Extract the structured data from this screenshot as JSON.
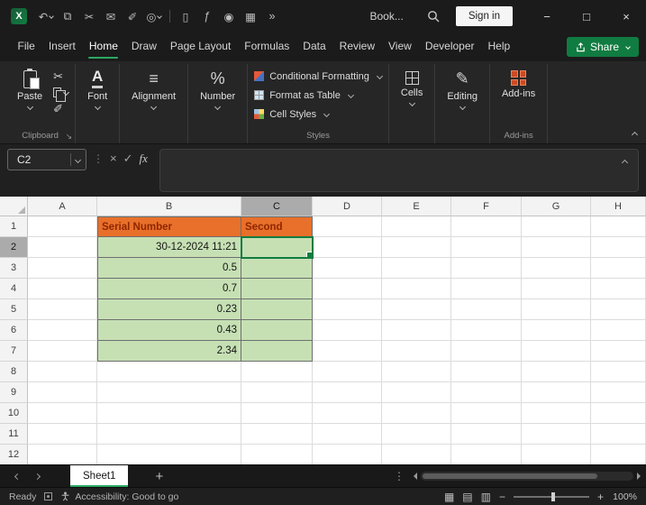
{
  "colors": {
    "accent_green": "#107C41",
    "underline_green": "#2BA862",
    "header_fill": "#E8702A",
    "header_text": "#8F2600",
    "data_fill": "#C6E0B4",
    "addins_orange": "#CE4A22",
    "selected_header_bg": "#ABABAB"
  },
  "titlebar": {
    "workbook_name": "Book...",
    "sign_in_label": "Sign in",
    "quick_access_icons": [
      {
        "name": "undo-icon",
        "glyph": "↶",
        "chevron": true
      },
      {
        "name": "copy-icon",
        "glyph": "⧉"
      },
      {
        "name": "cut-icon",
        "glyph": "✂"
      },
      {
        "name": "mail-icon",
        "glyph": "✉"
      },
      {
        "name": "format-painter-icon",
        "glyph": "✐"
      },
      {
        "name": "record-icon",
        "glyph": "◎",
        "chevron": true
      },
      {
        "name": "separator",
        "type": "sep"
      },
      {
        "name": "new-document-icon",
        "glyph": "▯"
      },
      {
        "name": "function-icon",
        "glyph": "ƒ"
      },
      {
        "name": "camera-icon",
        "glyph": "◉"
      },
      {
        "name": "table-icon",
        "glyph": "▦"
      },
      {
        "name": "more-commands-icon",
        "glyph": "»"
      }
    ]
  },
  "menubar": {
    "items": [
      "File",
      "Insert",
      "Home",
      "Draw",
      "Page Layout",
      "Formulas",
      "Data",
      "Review",
      "View",
      "Developer",
      "Help"
    ],
    "active_item": "Home",
    "share_label": "Share"
  },
  "ribbon": {
    "paste_label": "Paste",
    "font_label": "Font",
    "alignment_label": "Alignment",
    "number_label": "Number",
    "styles_buttons": [
      "Conditional Formatting",
      "Format as Table",
      "Cell Styles"
    ],
    "cells_label": "Cells",
    "editing_label": "Editing",
    "addins_label": "Add-ins",
    "group_labels": {
      "clipboard": "Clipboard",
      "styles": "Styles",
      "addins": "Add-ins"
    }
  },
  "formula_bar": {
    "name_box_value": "C2",
    "formula_value": ""
  },
  "grid": {
    "column_headers": [
      "A",
      "B",
      "C",
      "D",
      "E",
      "F",
      "G",
      "H"
    ],
    "row_headers": [
      "1",
      "2",
      "3",
      "4",
      "5",
      "6",
      "7",
      "8",
      "9",
      "10",
      "11",
      "12"
    ],
    "selected_column": "C",
    "selected_row": "2",
    "active_cell": "C2",
    "cells": [
      {
        "ref": "B1",
        "text": "Serial Number",
        "style": "header"
      },
      {
        "ref": "C1",
        "text": "Second",
        "style": "header"
      },
      {
        "ref": "B2",
        "text": "30-12-2024 11:21",
        "style": "data"
      },
      {
        "ref": "C2",
        "text": "",
        "style": "data"
      },
      {
        "ref": "B3",
        "text": "0.5",
        "style": "data"
      },
      {
        "ref": "C3",
        "text": "",
        "style": "data"
      },
      {
        "ref": "B4",
        "text": "0.7",
        "style": "data"
      },
      {
        "ref": "C4",
        "text": "",
        "style": "data"
      },
      {
        "ref": "B5",
        "text": "0.23",
        "style": "data"
      },
      {
        "ref": "C5",
        "text": "",
        "style": "data"
      },
      {
        "ref": "B6",
        "text": "0.43",
        "style": "data"
      },
      {
        "ref": "C6",
        "text": "",
        "style": "data"
      },
      {
        "ref": "B7",
        "text": "2.34",
        "style": "data"
      },
      {
        "ref": "C7",
        "text": "",
        "style": "data"
      }
    ]
  },
  "sheet_tabs": {
    "tabs": [
      "Sheet1"
    ],
    "active_tab": "Sheet1",
    "add_label": "+"
  },
  "status_bar": {
    "mode": "Ready",
    "accessibility": "Accessibility: Good to go",
    "zoom": "100%"
  }
}
